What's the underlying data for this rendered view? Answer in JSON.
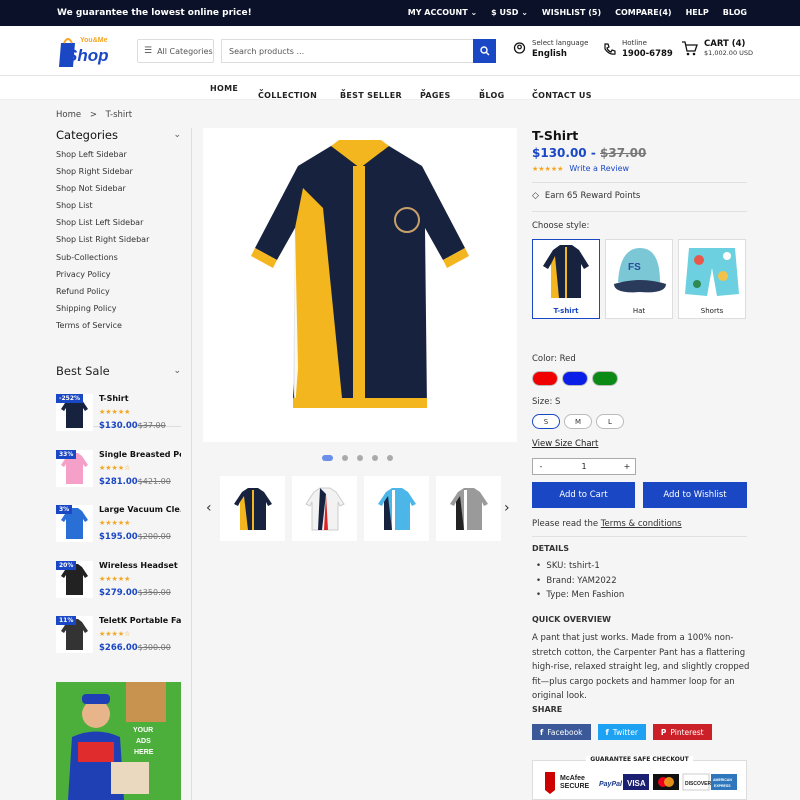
{
  "topbar": {
    "promo": "We guarantee the lowest online price!",
    "links": [
      "MY ACCOUNT",
      "$ USD",
      "WISHLIST (5)",
      "COMPARE(4)",
      "HELP",
      "BLOG"
    ]
  },
  "header": {
    "logo_top": "You&Me",
    "logo_main": "Shop",
    "category_button": "All Categories",
    "search_placeholder": "Search products ...",
    "language_label": "Select language",
    "language_value": "English",
    "hotline_label": "Hotline",
    "hotline_value": "1900-6789",
    "cart_label": "CART (4)",
    "cart_total": "$1,002.00 USD"
  },
  "nav": [
    "HOME",
    "COLLECTION",
    "BEST SELLER",
    "PAGES",
    "BLOG",
    "CONTACT US"
  ],
  "breadcrumb": {
    "home": "Home",
    "current": "T-shirt"
  },
  "sidebar": {
    "categories_title": "Categories",
    "categories": [
      "Shop Left Sidebar",
      "Shop Right Sidebar",
      "Shop Not Sidebar",
      "Shop List",
      "Shop List Left Sidebar",
      "Shop List Right Sidebar",
      "Sub-Collections",
      "Privacy Policy",
      "Refund Policy",
      "Shipping Policy",
      "Terms of Service"
    ],
    "best_sale_title": "Best Sale",
    "best_sale": [
      {
        "name": "T-Shirt",
        "badge": "-252%",
        "stars": "★★★★★",
        "price": "$130.00",
        "old": "$37.00"
      },
      {
        "name": "Single Breasted Po...",
        "badge": "33%",
        "stars": "★★★★☆",
        "price": "$281.00",
        "old": "$421.00"
      },
      {
        "name": "Large Vacuum Cle...",
        "badge": "3%",
        "stars": "★★★★★",
        "price": "$195.00",
        "old": "$200.00"
      },
      {
        "name": "Wireless Headset ...",
        "badge": "20%",
        "stars": "★★★★★",
        "price": "$279.00",
        "old": "$350.00"
      },
      {
        "name": "TeletK Portable Fan",
        "badge": "11%",
        "stars": "★★★★☆",
        "price": "$266.00",
        "old": "$300.00"
      }
    ],
    "ad_text": [
      "YOUR",
      "ADS",
      "HERE"
    ]
  },
  "product": {
    "title": "T-Shirt",
    "price": "$130.00",
    "old_price": "$37.00",
    "stars": "★★★★★",
    "write_review": "Write a Review",
    "reward": "Earn 65 Reward Points",
    "choose_style": "Choose style:",
    "styles": [
      "T-shirt",
      "Hat",
      "Shorts"
    ],
    "color_label": "Color: Red",
    "colors": [
      "#f00000",
      "#0a1ee8",
      "#0c8a16"
    ],
    "size_label": "Size: S",
    "sizes": [
      "S",
      "M",
      "L"
    ],
    "size_chart": "View Size Chart",
    "quantity": "1",
    "minus": "-",
    "plus": "+",
    "add_to_cart": "Add to Cart",
    "add_to_wishlist": "Add to Wishlist",
    "terms_prefix": "Please read the",
    "terms_link": "Terms & conditions",
    "details_title": "DETAILS",
    "details": [
      "SKU: tshirt-1",
      "Brand: YAM2022",
      "Type: Men Fashion"
    ],
    "overview_title": "QUICK OVERVIEW",
    "overview": "A pant that just works. Made from a 100% non-stretch cotton, the Carpenter Pant has a flattering high-rise, relaxed straight leg, and slightly cropped fit—plus cargo pockets and hammer loop for an original look.",
    "share_title": "SHARE",
    "share": [
      "Facebook",
      "Twitter",
      "Pinterest"
    ],
    "safe_checkout": "GUARANTEE SAFE CHECKOUT",
    "payments": [
      "McAfee SECURE",
      "PayPal",
      "VISA",
      "Mastercard",
      "DISCOVER",
      "AMERICAN EXPRESS"
    ]
  },
  "colors": {
    "accent": "#1a47c4",
    "topbar": "#0a1128",
    "star": "#f5a623",
    "facebook": "#3b5998",
    "twitter": "#1da1f2",
    "pinterest": "#cb2027"
  }
}
